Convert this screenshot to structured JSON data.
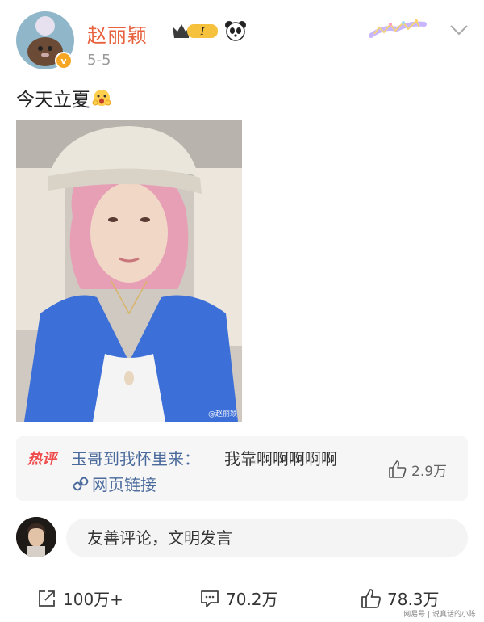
{
  "post": {
    "author": "赵丽颖",
    "vip_level": "I",
    "date": "5-5",
    "text": "今天立夏",
    "photo_watermark": "@赵丽颖"
  },
  "hot_comment": {
    "tag": "热评",
    "commenter": "玉哥到我怀里来：",
    "text": "我靠啊啊啊啊啊",
    "link_label": "网页链接",
    "likes": "2.9万"
  },
  "comment_box": {
    "placeholder": "友善评论，文明发言"
  },
  "actions": {
    "shares": "100万+",
    "comments": "70.2万",
    "likes": "78.3万"
  },
  "footer": {
    "source": "网易号 | 说真话的小陈"
  },
  "colors": {
    "username": "#e8603c",
    "link": "#4a6a9c",
    "hot_tag": "#f04c4c"
  },
  "icons": [
    "avatar",
    "verified-icon",
    "vip-crown-icon",
    "panda-icon",
    "chevron-down-icon",
    "link-icon",
    "thumb-up-icon",
    "share-icon",
    "comment-icon"
  ]
}
